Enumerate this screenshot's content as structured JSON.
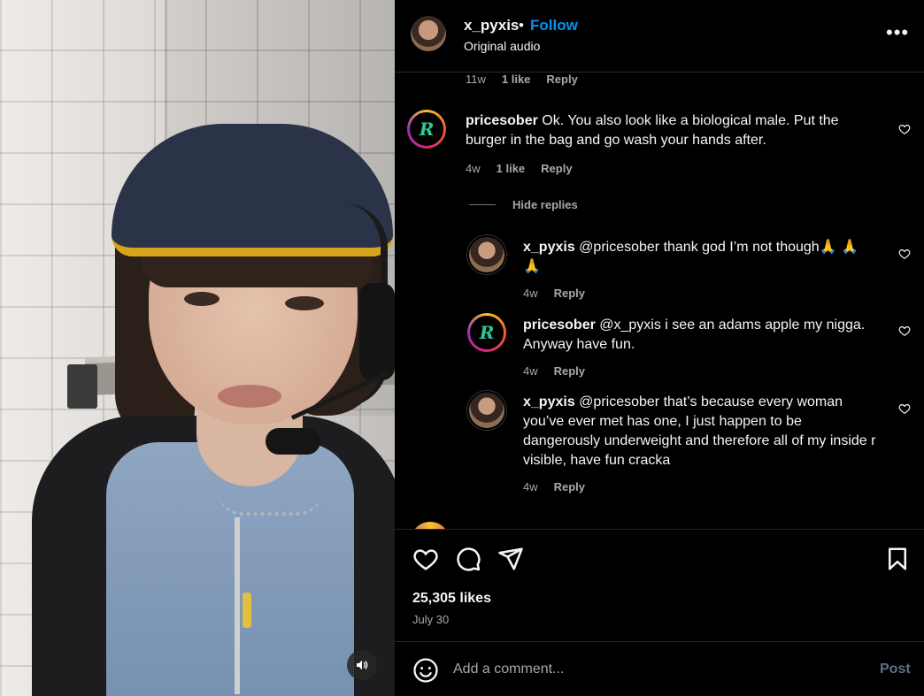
{
  "post": {
    "username": "x_pyxis",
    "separator": "•",
    "follow_label": "Follow",
    "audio": "Original audio",
    "more": "•••"
  },
  "comments": {
    "top_meta": {
      "time": "11w",
      "likes": "1 like",
      "reply": "Reply"
    },
    "main": {
      "username": "pricesober",
      "text": "Ok. You also look like a biological male. Put the burger in the bag and go wash your hands after.",
      "time": "4w",
      "likes": "1 like",
      "reply": "Reply"
    },
    "hide_replies": "Hide replies",
    "replies": [
      {
        "username": "x_pyxis",
        "text": "@pricesober thank god I’m not though🙏 🙏 🙏",
        "time": "4w",
        "reply": "Reply"
      },
      {
        "username": "pricesober",
        "text": "@x_pyxis i see an adams apple my nigga. Anyway have fun.",
        "time": "4w",
        "reply": "Reply"
      },
      {
        "username": "x_pyxis",
        "text": "@pricesober that’s because every woman you’ve ever met has one, I just happen to be dangerously underweight and therefore all of my inside r visible, have fun cracka",
        "time": "4w",
        "reply": "Reply"
      }
    ]
  },
  "stats": {
    "likes": "25,305 likes",
    "date": "July 30"
  },
  "composer": {
    "placeholder": "Add a comment...",
    "post_label": "Post"
  },
  "icons": {
    "like": "heart-icon",
    "comment": "comment-icon",
    "share": "share-icon",
    "save": "bookmark-icon",
    "emoji": "emoji-icon",
    "sound": "speaker-icon"
  },
  "colors": {
    "follow": "#0095f6",
    "background": "#000000",
    "muted": "#a8a8a8",
    "rockstar_green": "#2fc79a"
  }
}
